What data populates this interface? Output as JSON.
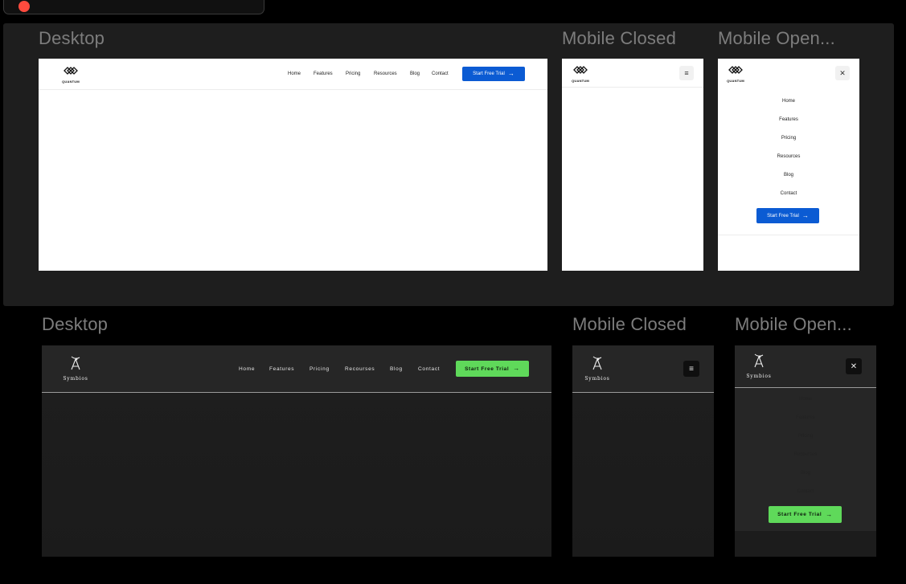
{
  "tab_pill": {
    "accent": "#ff4b3e"
  },
  "section_light": {
    "labels": {
      "desktop": "Desktop",
      "mobile_closed": "Mobile Closed",
      "mobile_open": "Mobile Open..."
    },
    "brand": "QUANTUM",
    "nav": [
      "Home",
      "Features",
      "Pricing",
      "Resources",
      "Blog",
      "Contact"
    ],
    "cta": "Start Free Trial",
    "accent": "#0b5bd3",
    "menu_icon": "hamburger-icon",
    "close_icon": "close-icon"
  },
  "section_dark": {
    "labels": {
      "desktop": "Desktop",
      "mobile_closed": "Mobile Closed",
      "mobile_open": "Mobile Open..."
    },
    "brand": "Symbios",
    "nav": [
      "Home",
      "Features",
      "Pricing",
      "Recourses",
      "Blog",
      "Contact"
    ],
    "cta": "Start Free Trial",
    "accent": "#5fd95a",
    "menu_icon": "hamburger-icon",
    "close_icon": "close-icon"
  }
}
